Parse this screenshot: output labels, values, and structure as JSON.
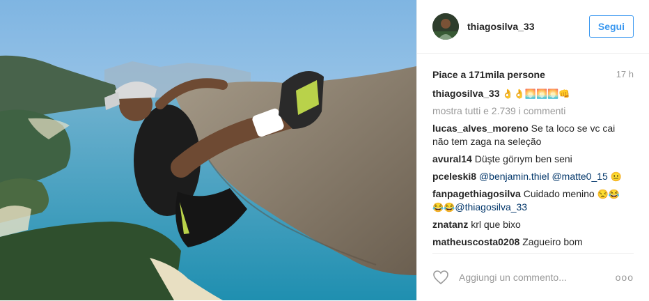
{
  "post": {
    "username": "thiagosilva_33",
    "follow_label": "Segui",
    "likes_text": "Piace a 171mila persone",
    "time": "17 h",
    "caption_user": "thiagosilva_33",
    "caption_emoji": "👌👌🌅🌅🌅👊",
    "show_all": "mostra tutti e 2.739 i commenti",
    "add_comment_placeholder": "Aggiungi un commento...",
    "more_label": "ooo"
  },
  "comments": [
    {
      "user": "lucas_alves_moreno",
      "text": "Se ta loco se vc cai não tem zaga na seleção"
    },
    {
      "user": "avural14",
      "text": "Düşte görıym ben seni"
    },
    {
      "user": "pceleski8",
      "mention1": "@benjamin.thiel",
      "mention2": "@matte0_15",
      "emoji": "😐"
    },
    {
      "user": "fanpagethiagosilva",
      "text": "Cuidado menino",
      "emoji1": "😒😂",
      "emoji2": "😂😂",
      "mention": "@thiagosilva_33"
    },
    {
      "user": "znatanz",
      "text": "krl que bixo"
    },
    {
      "user": "matheuscosta0208",
      "text": "Zagueiro bom"
    }
  ],
  "icons": {
    "heart": "heart-icon",
    "more": "more-options-icon"
  }
}
